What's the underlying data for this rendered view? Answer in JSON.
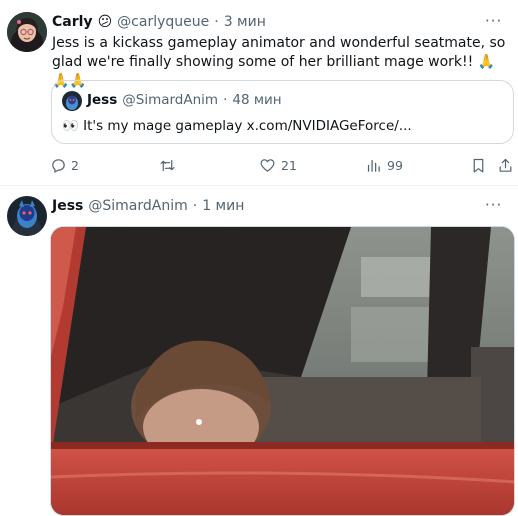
{
  "tweet1": {
    "author_name": "Carly",
    "author_emoji": "😕",
    "handle": "@carlyqueue",
    "separator": "·",
    "time": "3 мин",
    "more": "···",
    "text": "Jess is a kickass gameplay animator and wonderful seatmate, so glad we're finally showing some of her brilliant mage work!! 🙏🙏🙏",
    "quote": {
      "author_name": "Jess",
      "handle": "@SimardAnim",
      "separator": "·",
      "time": "48 мин",
      "text": "👀 It's my mage gameplay x.com/NVIDIAGeForce/..."
    },
    "actions": {
      "replies": "2",
      "retweets": "",
      "likes": "21",
      "views": "99"
    }
  },
  "tweet2": {
    "author_name": "Jess",
    "handle": "@SimardAnim",
    "separator": "·",
    "time": "1 мин",
    "more": "···"
  },
  "colors": {
    "text": "#0f1419",
    "muted": "#536471",
    "border": "#cfd9de",
    "car_red": "#c5463a"
  },
  "icons": [
    "reply-icon",
    "retweet-icon",
    "like-icon",
    "views-icon",
    "bookmark-icon",
    "share-icon",
    "more-icon"
  ]
}
